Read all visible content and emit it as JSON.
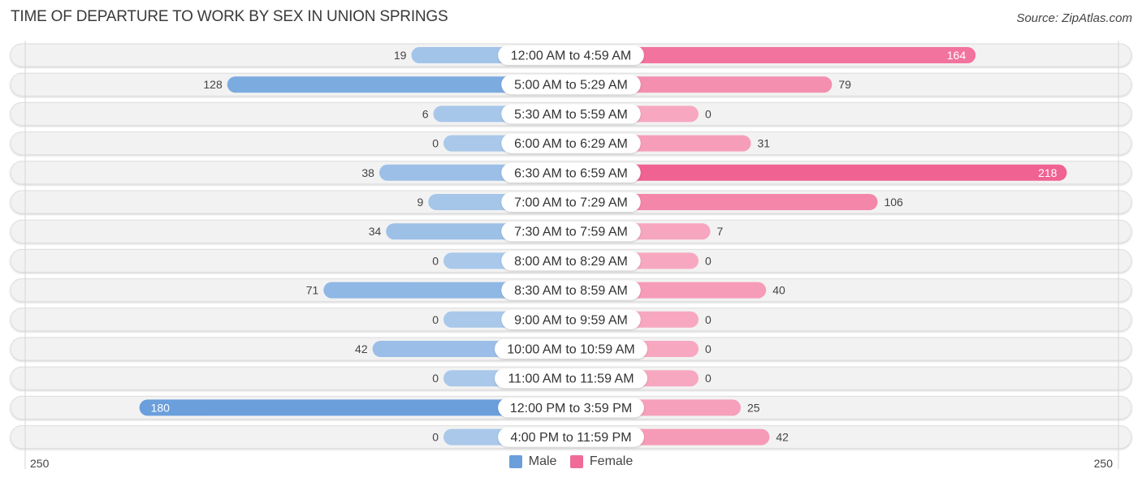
{
  "header": {
    "title": "TIME OF DEPARTURE TO WORK BY SEX IN UNION SPRINGS",
    "source": "Source: ZipAtlas.com"
  },
  "colors": {
    "male_dark": "#6a9fdc",
    "male_light": "#a9c8ea",
    "female_dark": "#f06292",
    "female_light": "#f7a8c0",
    "row_bg": "#f2f2f2"
  },
  "legend": [
    {
      "label": "Male",
      "color": "#6a9fdc"
    },
    {
      "label": "Female",
      "color": "#f06b97"
    }
  ],
  "chart_data": {
    "type": "bar",
    "orientation": "horizontal-diverging",
    "title": "TIME OF DEPARTURE TO WORK BY SEX IN UNION SPRINGS",
    "categories": [
      "12:00 AM to 4:59 AM",
      "5:00 AM to 5:29 AM",
      "5:30 AM to 5:59 AM",
      "6:00 AM to 6:29 AM",
      "6:30 AM to 6:59 AM",
      "7:00 AM to 7:29 AM",
      "7:30 AM to 7:59 AM",
      "8:00 AM to 8:29 AM",
      "8:30 AM to 8:59 AM",
      "9:00 AM to 9:59 AM",
      "10:00 AM to 10:59 AM",
      "11:00 AM to 11:59 AM",
      "12:00 PM to 3:59 PM",
      "4:00 PM to 11:59 PM"
    ],
    "series": [
      {
        "name": "Male",
        "values": [
          19,
          128,
          6,
          0,
          38,
          9,
          34,
          0,
          71,
          0,
          42,
          0,
          180,
          0
        ]
      },
      {
        "name": "Female",
        "values": [
          164,
          79,
          0,
          31,
          218,
          106,
          7,
          0,
          40,
          0,
          0,
          0,
          25,
          42
        ]
      }
    ],
    "axis": {
      "left_label": "250",
      "right_label": "250",
      "max": 250
    },
    "legend_position": "bottom-center"
  }
}
